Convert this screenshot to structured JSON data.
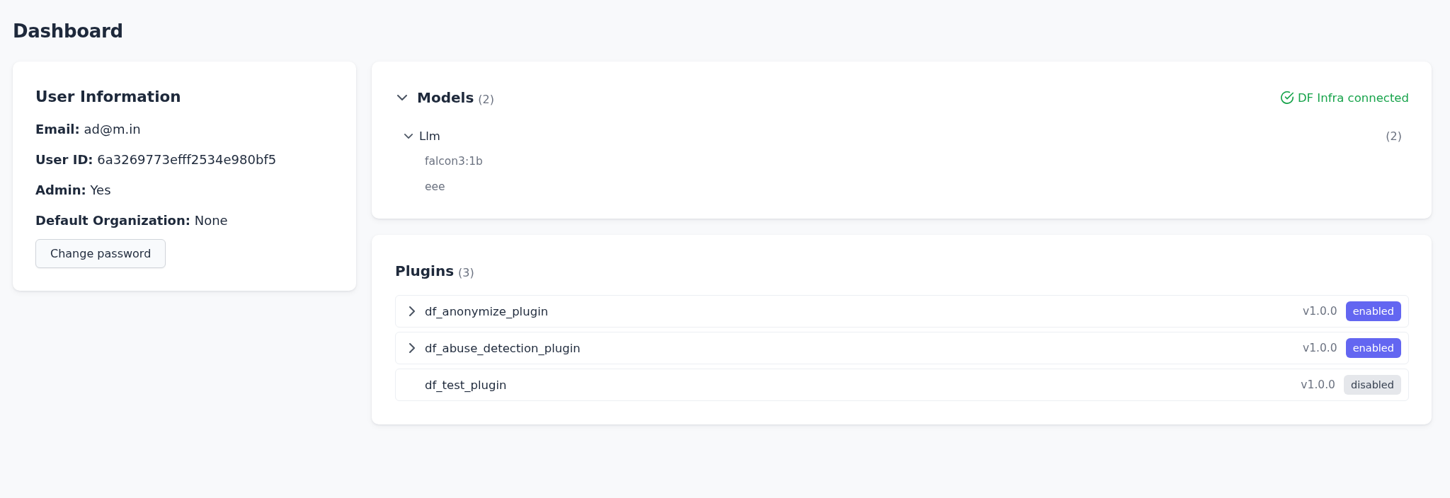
{
  "page": {
    "title": "Dashboard"
  },
  "user_information": {
    "title": "User Information",
    "details": [
      "**Email:** ad@m.in",
      "**User ID:** 6a3269773efff2534e980bf5",
      "**Admin:** Yes",
      "**Default Organization:** None"
    ],
    "button": "Change password"
  },
  "models": {
    "title": "Models",
    "count": "(2)",
    "expanded": true,
    "status": {
      "text": "DF Infra connected",
      "connected": true
    },
    "groups": [
      {
        "name": "Llm",
        "count": "(2)",
        "expanded": true,
        "children": [
          {
            "name": "falcon3:1b"
          },
          {
            "name": "eee"
          }
        ]
      }
    ]
  },
  "plugins": {
    "title": "Plugins",
    "count": "(3)",
    "items": [
      {
        "name": "df_anonymize_plugin",
        "version": "v1.0.0",
        "status": "enabled",
        "enabled": true,
        "expandable": true,
        "expanded": false
      },
      {
        "name": "df_abuse_detection_plugin",
        "version": "v1.0.0",
        "status": "enabled",
        "enabled": true,
        "expandable": true,
        "expanded": false
      },
      {
        "name": "df_test_plugin",
        "version": "v1.0.0",
        "status": "disabled",
        "enabled": false,
        "expandable": false
      }
    ]
  }
}
